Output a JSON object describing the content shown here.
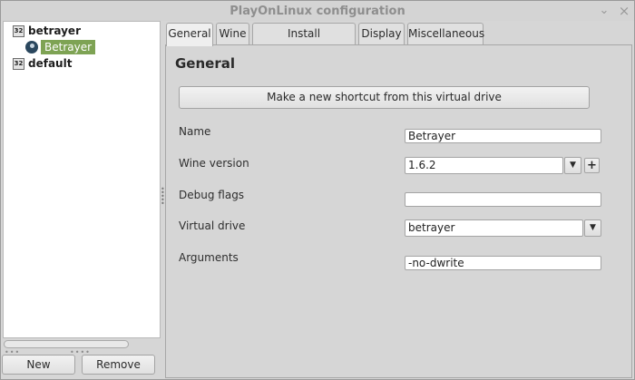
{
  "window": {
    "title": "PlayOnLinux configuration",
    "minimize_glyph": "⌄",
    "close_glyph": "×"
  },
  "tree": {
    "items": [
      {
        "label": "betrayer",
        "icon": "drive-32-icon",
        "icon_text": "32"
      },
      {
        "label": "Betrayer",
        "icon": "steam-icon",
        "selected": true
      },
      {
        "label": "default",
        "icon": "drive-32-icon",
        "icon_text": "32"
      }
    ]
  },
  "left_buttons": {
    "new_label": "New",
    "remove_label": "Remove"
  },
  "tabs": [
    {
      "label": "General",
      "active": true
    },
    {
      "label": "Wine"
    },
    {
      "label": "Install components"
    },
    {
      "label": "Display"
    },
    {
      "label": "Miscellaneous"
    }
  ],
  "general": {
    "heading": "General",
    "shortcut_button_label": "Make a new shortcut from this virtual drive",
    "name_label": "Name",
    "name_value": "Betrayer",
    "wine_version_label": "Wine version",
    "wine_version_value": "1.6.2",
    "debug_flags_label": "Debug flags",
    "debug_flags_value": "",
    "virtual_drive_label": "Virtual drive",
    "virtual_drive_value": "betrayer",
    "arguments_label": "Arguments",
    "arguments_value": "-no-dwrite"
  },
  "colors": {
    "selection": "#7ea354",
    "background": "#d6d6d6"
  }
}
